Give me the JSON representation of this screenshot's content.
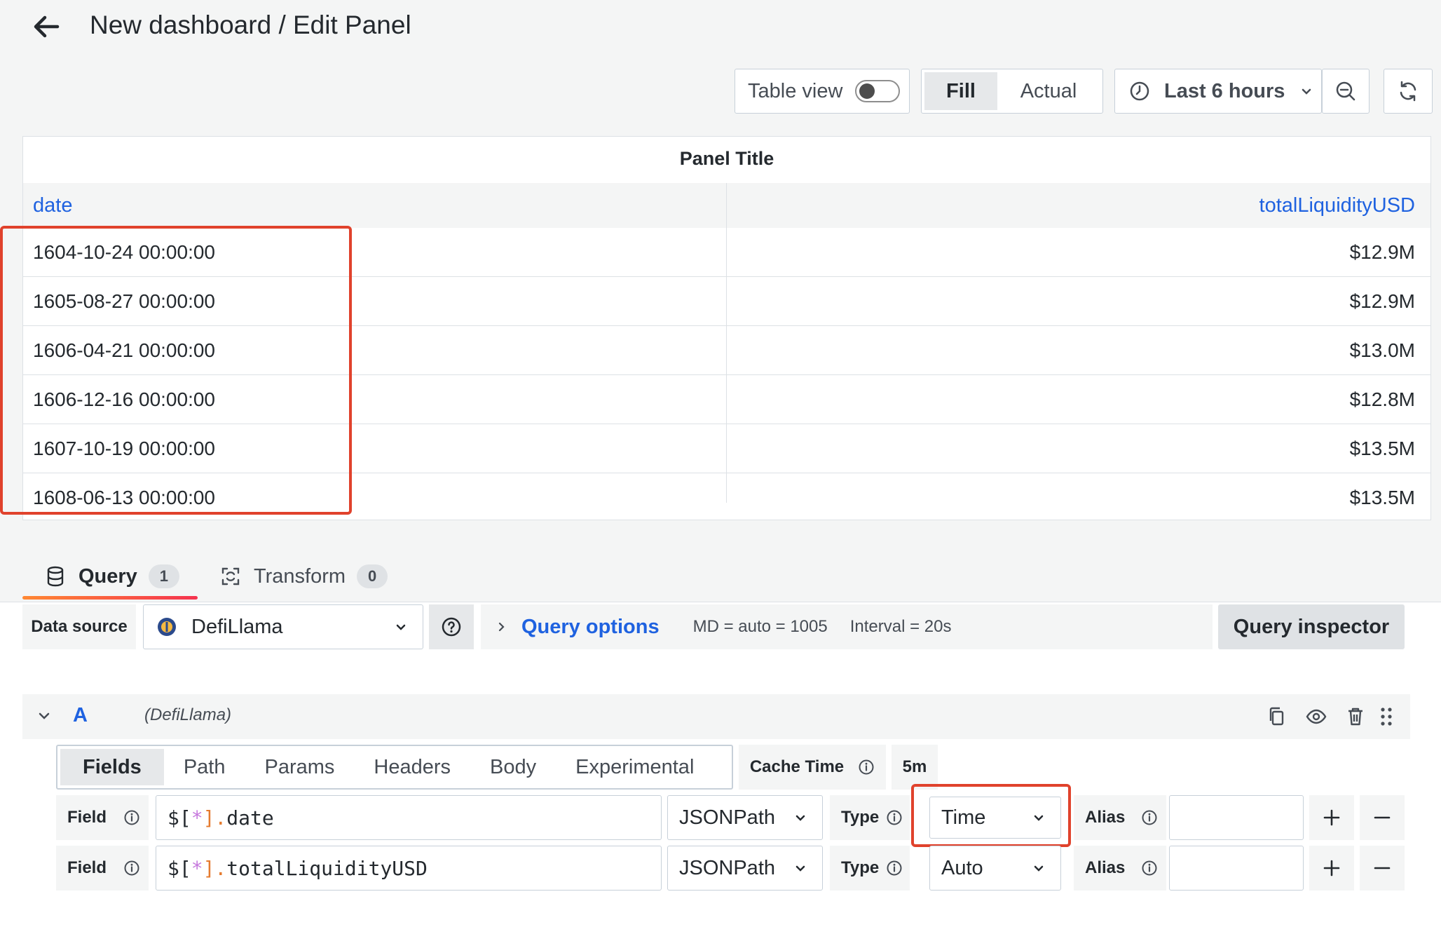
{
  "header": {
    "title": "New dashboard / Edit Panel"
  },
  "toolbar": {
    "table_view_label": "Table view",
    "table_view_on": false,
    "fill_label": "Fill",
    "actual_label": "Actual",
    "time_range": "Last 6 hours"
  },
  "panel": {
    "title": "Panel Title",
    "columns": [
      "date",
      "totalLiquidityUSD"
    ],
    "rows": [
      {
        "date": "1604-10-24 00:00:00",
        "value": "$12.9M"
      },
      {
        "date": "1605-08-27 00:00:00",
        "value": "$12.9M"
      },
      {
        "date": "1606-04-21 00:00:00",
        "value": "$13.0M"
      },
      {
        "date": "1606-12-16 00:00:00",
        "value": "$12.8M"
      },
      {
        "date": "1607-10-19 00:00:00",
        "value": "$13.5M"
      },
      {
        "date": "1608-06-13 00:00:00",
        "value": "$13.5M"
      }
    ]
  },
  "tabs": {
    "query_label": "Query",
    "query_count": "1",
    "transform_label": "Transform",
    "transform_count": "0"
  },
  "datasource": {
    "label": "Data source",
    "selected": "DefiLlama",
    "query_options_label": "Query options",
    "md": "MD = auto = 1005",
    "interval": "Interval = 20s",
    "inspector_label": "Query inspector"
  },
  "query": {
    "name": "A",
    "datasource": "(DefiLlama)",
    "subtabs": [
      "Fields",
      "Path",
      "Params",
      "Headers",
      "Body",
      "Experimental"
    ],
    "cache_label": "Cache Time",
    "cache_value": "5m",
    "fields": [
      {
        "label": "Field",
        "prefix": "$[",
        "star": "*",
        "suffix": "].",
        "path": "date",
        "lang": "JSONPath",
        "type_label": "Type",
        "type": "Time",
        "alias_label": "Alias",
        "alias": ""
      },
      {
        "label": "Field",
        "prefix": "$[",
        "star": "*",
        "suffix": "].",
        "path": "totalLiquidityUSD",
        "lang": "JSONPath",
        "type_label": "Type",
        "type": "Auto",
        "alias_label": "Alias",
        "alias": ""
      }
    ]
  },
  "colors": {
    "link_blue": "#1f62e0",
    "highlight_red": "#e0422c",
    "tab_gradient_start": "#ff8833",
    "tab_gradient_end": "#f5334f"
  }
}
